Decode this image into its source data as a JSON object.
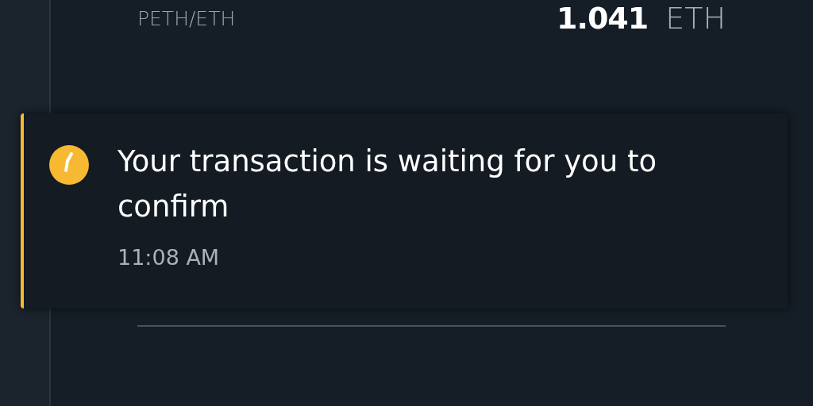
{
  "rates": [
    {
      "pair": "PETH/ETH",
      "value": "1.041",
      "unit": "ETH"
    }
  ],
  "toast": {
    "kind": "pending",
    "message": "Your transaction is waiting for you to confirm",
    "time": "11:08 AM"
  }
}
